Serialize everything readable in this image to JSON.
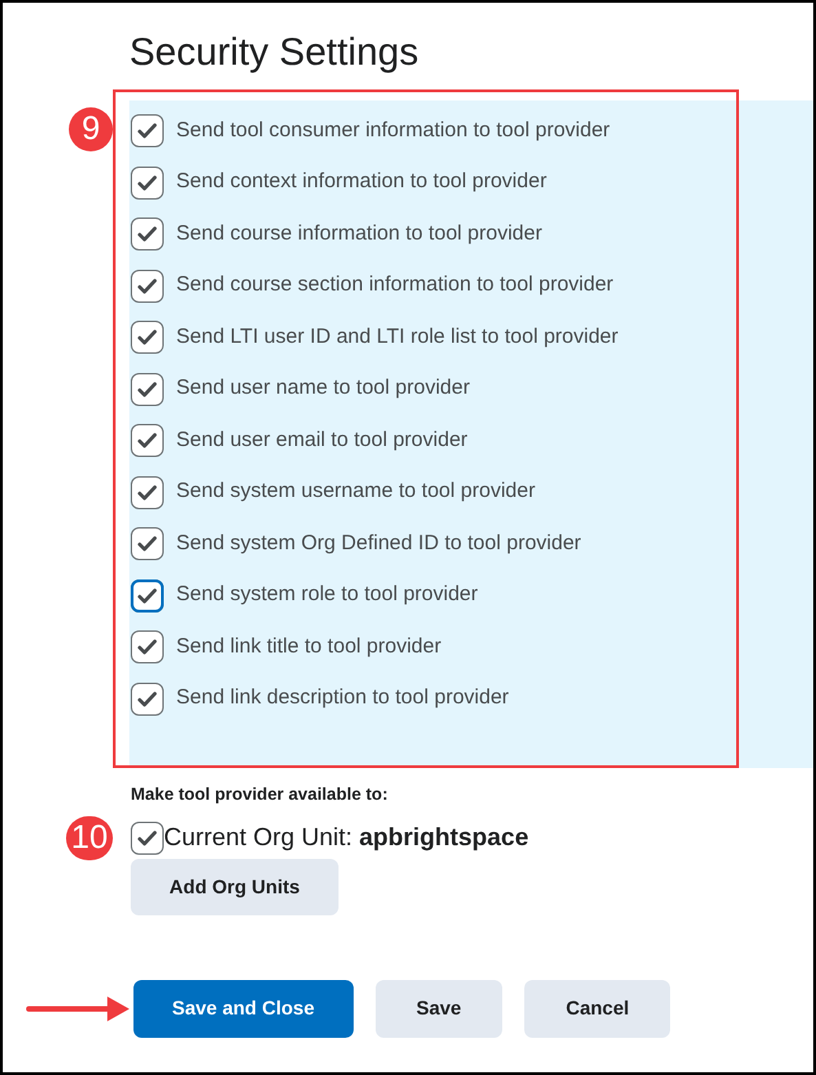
{
  "title": "Security Settings",
  "callouts": [
    "9",
    "10"
  ],
  "options": [
    {
      "label": "Send tool consumer information to tool provider",
      "checked": true,
      "focused": false
    },
    {
      "label": "Send context information to tool provider",
      "checked": true,
      "focused": false
    },
    {
      "label": "Send course information to tool provider",
      "checked": true,
      "focused": false
    },
    {
      "label": "Send course section information to tool provider",
      "checked": true,
      "focused": false
    },
    {
      "label": "Send LTI user ID and LTI role list to tool provider",
      "checked": true,
      "focused": false
    },
    {
      "label": "Send user name to tool provider",
      "checked": true,
      "focused": false
    },
    {
      "label": "Send user email to tool provider",
      "checked": true,
      "focused": false
    },
    {
      "label": "Send system username to tool provider",
      "checked": true,
      "focused": false
    },
    {
      "label": "Send system Org Defined ID to tool provider",
      "checked": true,
      "focused": false
    },
    {
      "label": "Send system role to tool provider",
      "checked": true,
      "focused": true
    },
    {
      "label": "Send link title to tool provider",
      "checked": true,
      "focused": false
    },
    {
      "label": "Send link description to tool provider",
      "checked": true,
      "focused": false
    }
  ],
  "availability": {
    "heading": "Make tool provider available to:",
    "org_unit": {
      "label": "Current Org Unit: **apbrightspace**",
      "checked": true
    },
    "add_button": "Add Org Units"
  },
  "buttons": [
    {
      "label": "Save and Close",
      "kind": "primary"
    },
    {
      "label": "Save",
      "kind": "secondary"
    },
    {
      "label": "Cancel",
      "kind": "secondary"
    }
  ]
}
